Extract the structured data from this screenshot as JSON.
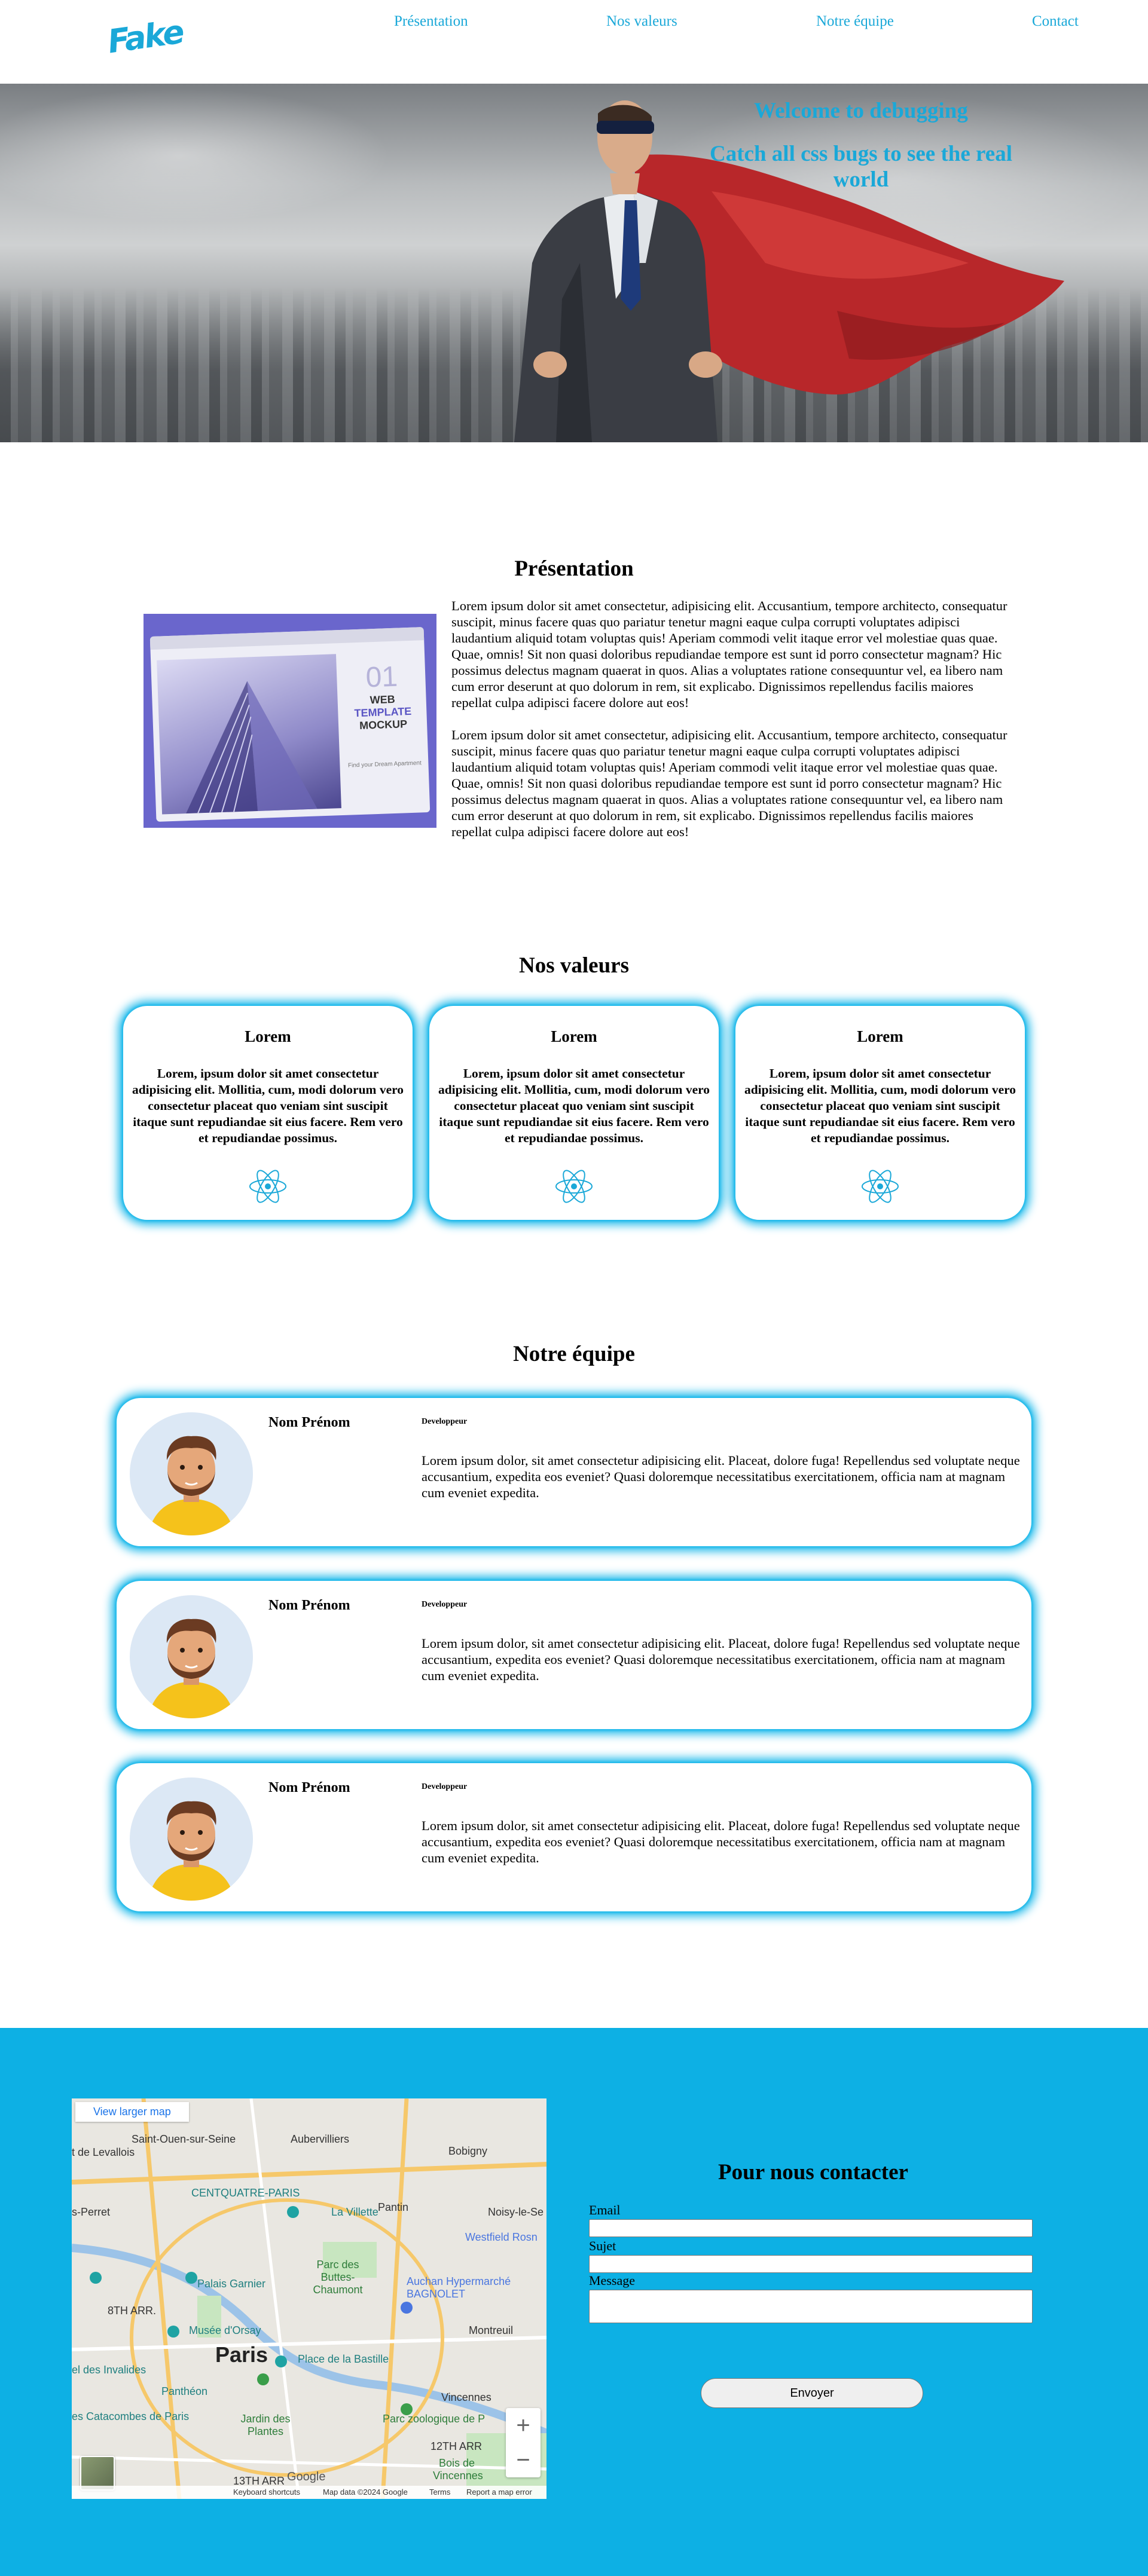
{
  "header": {
    "logo_text": "Fake",
    "nav": [
      {
        "label": "Présentation"
      },
      {
        "label": "Nos valeurs"
      },
      {
        "label": "Notre équipe"
      },
      {
        "label": "Contact"
      }
    ]
  },
  "hero": {
    "title": "Welcome to debugging",
    "subtitle": "Catch all css bugs to see the real world"
  },
  "presentation": {
    "title": "Présentation",
    "image_text": {
      "number": "01",
      "line1": "WEB",
      "line2": "TEMPLATE",
      "line3": "MOCKUP",
      "caption": "Find your Dream Apartment"
    },
    "paragraphs": [
      "Lorem ipsum dolor sit amet consectetur, adipisicing elit. Accusantium, tempore architecto, consequatur suscipit, minus facere quas quo pariatur tenetur magni eaque culpa corrupti voluptates adipisci laudantium aliquid totam voluptas quis! Aperiam commodi velit itaque error vel molestiae quas quae. Quae, omnis! Sit non quasi doloribus repudiandae tempore est sunt id porro consectetur magnam? Hic possimus delectus magnam quaerat in quos. Alias a voluptates ratione consequuntur vel, ea libero nam cum error deserunt at quo dolorum in rem, sit explicabo. Dignissimos repellendus facilis maiores repellat culpa adipisci facere dolore aut eos!",
      "Lorem ipsum dolor sit amet consectetur, adipisicing elit. Accusantium, tempore architecto, consequatur suscipit, minus facere quas quo pariatur tenetur magni eaque culpa corrupti voluptates adipisci laudantium aliquid totam voluptas quis! Aperiam commodi velit itaque error vel molestiae quas quae. Quae, omnis! Sit non quasi doloribus repudiandae tempore est sunt id porro consectetur magnam? Hic possimus delectus magnam quaerat in quos. Alias a voluptates ratione consequuntur vel, ea libero nam cum error deserunt at quo dolorum in rem, sit explicabo. Dignissimos repellendus facilis maiores repellat culpa adipisci facere dolore aut eos!"
    ]
  },
  "values": {
    "title": "Nos valeurs",
    "cards": [
      {
        "title": "Lorem",
        "text": "Lorem, ipsum dolor sit amet consectetur adipisicing elit. Mollitia, cum, modi dolorum vero consectetur placeat quo veniam sint suscipit itaque sunt repudiandae sit eius facere. Rem vero et repudiandae possimus.",
        "icon": "react-icon"
      },
      {
        "title": "Lorem",
        "text": "Lorem, ipsum dolor sit amet consectetur adipisicing elit. Mollitia, cum, modi dolorum vero consectetur placeat quo veniam sint suscipit itaque sunt repudiandae sit eius facere. Rem vero et repudiandae possimus.",
        "icon": "react-icon"
      },
      {
        "title": "Lorem",
        "text": "Lorem, ipsum dolor sit amet consectetur adipisicing elit. Mollitia, cum, modi dolorum vero consectetur placeat quo veniam sint suscipit itaque sunt repudiandae sit eius facere. Rem vero et repudiandae possimus.",
        "icon": "react-icon"
      }
    ]
  },
  "team": {
    "title": "Notre équipe",
    "members": [
      {
        "name": "Nom Prénom",
        "role": "Developpeur",
        "bio": "Lorem ipsum dolor, sit amet consectetur adipisicing elit. Placeat, dolore fuga! Repellendus sed voluptate neque accusantium, expedita eos eveniet? Quasi doloremque necessitatibus exercitationem, officia nam at magnam cum eveniet expedita."
      },
      {
        "name": "Nom Prénom",
        "role": "Developpeur",
        "bio": "Lorem ipsum dolor, sit amet consectetur adipisicing elit. Placeat, dolore fuga! Repellendus sed voluptate neque accusantium, expedita eos eveniet? Quasi doloremque necessitatibus exercitationem, officia nam at magnam cum eveniet expedita."
      },
      {
        "name": "Nom Prénom",
        "role": "Developpeur",
        "bio": "Lorem ipsum dolor, sit amet consectetur adipisicing elit. Placeat, dolore fuga! Repellendus sed voluptate neque accusantium, expedita eos eveniet? Quasi doloremque necessitatibus exercitationem, officia nam at magnam cum eveniet expedita."
      }
    ]
  },
  "contact": {
    "title": "Pour nous contacter",
    "labels": {
      "email": "Email",
      "subject": "Sujet",
      "message": "Message"
    },
    "values": {
      "email": "",
      "subject": "",
      "message": ""
    },
    "submit_label": "Envoyer",
    "map": {
      "link": "View larger map",
      "labels": [
        "Saint-Ouen-sur-Seine",
        "Aubervilliers",
        "Bobigny",
        "CENTQUATRE-PARIS",
        "s-Perret",
        "Pantin",
        "Noisy-le-Se",
        "La Villette",
        "Westfield Rosn",
        "Palais Garnier",
        "Parc des Buttes-Chaumont",
        "Auchan Hypermarché BAGNOLET",
        "8TH ARR.",
        "Musée d'Orsay",
        "Paris",
        "Place de la Bastille",
        "Montreuil",
        "el des Invalides",
        "Panthéon",
        "es Catacombes de Paris",
        "Jardin des Plantes",
        "Parc zoologique de P",
        "12TH ARR",
        "Vincennes",
        "Bois de Vincennes",
        "13TH ARR",
        "t de Levallois"
      ],
      "footer": {
        "shortcuts": "Keyboard shortcuts",
        "mapdata": "Map data ©2024 Google",
        "terms": "Terms",
        "report": "Report a map error",
        "brand": "Google"
      },
      "zoom_in": "+",
      "zoom_out": "−"
    }
  },
  "colors": {
    "accent": "#1aa8d8",
    "glow": "#1ab8ea",
    "contact_bg": "#0db0e4"
  }
}
